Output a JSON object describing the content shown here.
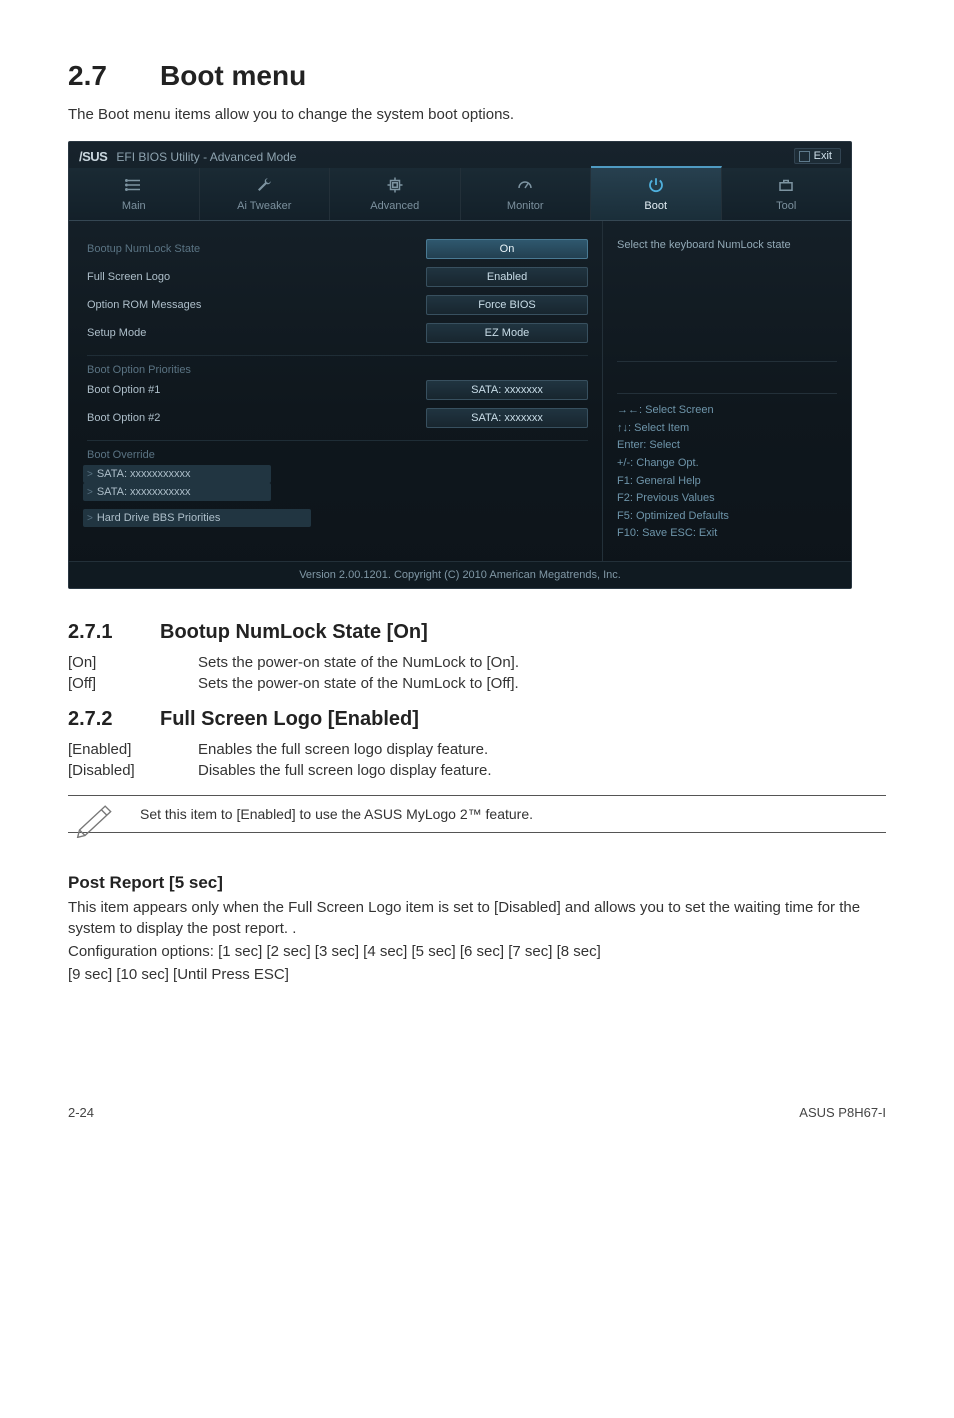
{
  "heading": {
    "number": "2.7",
    "title": "Boot menu"
  },
  "lead": "The Boot menu items allow you to change the system boot options.",
  "bios": {
    "title_logo": "/SUS",
    "title_text": "EFI BIOS Utility - Advanced Mode",
    "exit": "Exit",
    "tabs": [
      "Main",
      "Ai  Tweaker",
      "Advanced",
      "Monitor",
      "Boot",
      "Tool"
    ],
    "active_tab_index": 4,
    "settings": [
      {
        "label": "Bootup NumLock State",
        "value": "On",
        "highlight": true,
        "dim": true
      },
      {
        "label": "Full Screen Logo",
        "value": "Enabled"
      },
      {
        "label": "Option ROM Messages",
        "value": "Force BIOS"
      },
      {
        "label": "Setup Mode",
        "value": "EZ Mode"
      }
    ],
    "boot_priorities_heading": "Boot Option Priorities",
    "boot_options": [
      {
        "label": "Boot Option #1",
        "value": "SATA: xxxxxxx"
      },
      {
        "label": "Boot Option #2",
        "value": "SATA: xxxxxxx"
      }
    ],
    "boot_override_heading": "Boot Override",
    "override_items": [
      "SATA: xxxxxxxxxxx",
      "SATA: xxxxxxxxxxx"
    ],
    "hdd_bbs": "Hard Drive BBS Priorities",
    "help": "Select the keyboard NumLock state",
    "hints": [
      "→←:  Select Screen",
      "↑↓:  Select Item",
      "Enter:  Select",
      "+/-:  Change Opt.",
      "F1:  General Help",
      "F2:  Previous Values",
      "F5:  Optimized Defaults",
      "F10:  Save   ESC:  Exit"
    ],
    "footer": "Version  2.00.1201.   Copyright  (C)  2010 American  Megatrends,  Inc."
  },
  "sub1": {
    "number": "2.7.1",
    "title": "Bootup NumLock State [On]",
    "rows": [
      {
        "k": "[On]",
        "v": "Sets the power-on state of the NumLock to [On]."
      },
      {
        "k": "[Off]",
        "v": "Sets the power-on state of the NumLock to [Off]."
      }
    ]
  },
  "sub2": {
    "number": "2.7.2",
    "title": "Full Screen Logo [Enabled]",
    "rows": [
      {
        "k": "[Enabled]",
        "v": "Enables the full screen logo display feature."
      },
      {
        "k": "[Disabled]",
        "v": "Disables the full screen logo display feature."
      }
    ]
  },
  "note": "Set this item to [Enabled] to use the ASUS MyLogo 2™ feature.",
  "post_report": {
    "heading": "Post Report [5 sec]",
    "p1": "This item appears only when the Full Screen Logo item is set to [Disabled] and allows you to set the waiting time for the system to display the post report. .",
    "p2": "Configuration options: [1 sec] [2 sec] [3 sec] [4 sec] [5 sec] [6 sec] [7 sec] [8 sec]",
    "p3": "[9 sec] [10 sec] [Until Press ESC]"
  },
  "footer": {
    "left": "2-24",
    "right": "ASUS P8H67-I"
  }
}
